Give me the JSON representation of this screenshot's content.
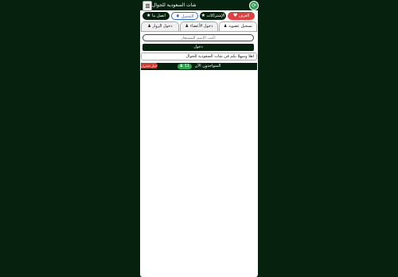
{
  "app": {
    "title": "شات السعودية للجوال",
    "menu_icon": "hamburger-icon",
    "refresh_icon": "refresh-icon",
    "accent": "#06220f"
  },
  "chips": {
    "contact_label": "اتصل بنا",
    "contact_icon": "star-icon",
    "instant_label": "التحميل",
    "instant_icon": "diamond-icon",
    "subs_label": "الإشتراكات",
    "subs_icon": "star-icon",
    "rooms_label": "الغرف",
    "rooms_icon": "heart-icon"
  },
  "tabs": {
    "visitor_login": "دخول الزوار",
    "member_login": "دخول الأعضاء",
    "register": "تسجيل عضوية"
  },
  "login": {
    "username_placeholder": "اكتب الإسم المستعار",
    "submit_label": "دخول"
  },
  "welcome_text": "اهلا وسهلا بكم في شات السعودية للجوال",
  "online": {
    "label": "المتواجدون الآن",
    "count": "11",
    "notice_label": "اخبار مشرف"
  }
}
